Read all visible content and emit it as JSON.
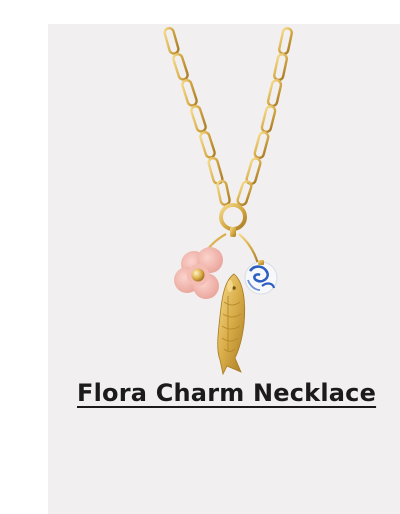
{
  "product": {
    "title": "Flora Charm Necklace",
    "image_icon": "necklace-product-photo",
    "colors": {
      "card_background": "#f1eff0",
      "title_text": "#1b1b1b",
      "gold": "#d8ac48",
      "flower_pink": "#f2b5ac",
      "porcelain_blue": "#2d5fc0"
    }
  }
}
